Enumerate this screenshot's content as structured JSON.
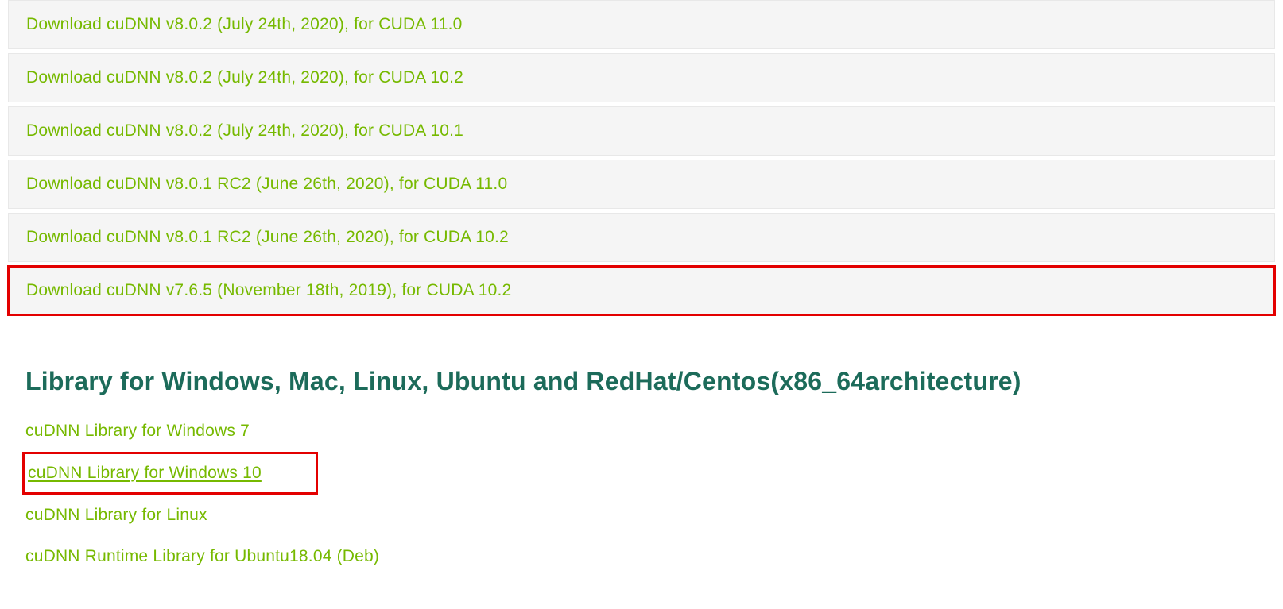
{
  "accordion": [
    {
      "label": "Download cuDNN v8.0.2 (July 24th, 2020), for CUDA 11.0",
      "highlighted": false
    },
    {
      "label": "Download cuDNN v8.0.2 (July 24th, 2020), for CUDA 10.2",
      "highlighted": false
    },
    {
      "label": "Download cuDNN v8.0.2 (July 24th, 2020), for CUDA 10.1",
      "highlighted": false
    },
    {
      "label": "Download cuDNN v8.0.1 RC2 (June 26th, 2020), for CUDA 11.0",
      "highlighted": false
    },
    {
      "label": "Download cuDNN v8.0.1 RC2 (June 26th, 2020), for CUDA 10.2",
      "highlighted": false
    },
    {
      "label": "Download cuDNN v7.6.5 (November 18th, 2019), for CUDA 10.2",
      "highlighted": true
    }
  ],
  "section_heading": "Library for Windows, Mac, Linux, Ubuntu and RedHat/Centos(x86_64architecture)",
  "downloads": [
    {
      "label": "cuDNN Library for Windows 7",
      "highlighted": false,
      "underlined": false
    },
    {
      "label": "cuDNN Library for Windows 10",
      "highlighted": true,
      "underlined": true
    },
    {
      "label": "cuDNN Library for Linux",
      "highlighted": false,
      "underlined": false
    },
    {
      "label": "cuDNN Runtime Library for Ubuntu18.04 (Deb)",
      "highlighted": false,
      "underlined": false
    }
  ]
}
